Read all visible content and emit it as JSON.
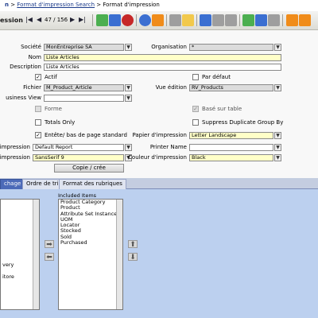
{
  "breadcrumb": {
    "home": "n",
    "sep": ">",
    "link": "Format d'impression Search",
    "current": "Format d'impression"
  },
  "toolbar": {
    "title": "ession",
    "nav_first": "|◀",
    "nav_prev": "◀",
    "record_count": "47 / 156",
    "nav_next": "▶",
    "nav_last": "▶|",
    "colors": {
      "green": "#4caf50",
      "blue": "#3b6fd1",
      "red": "#c62828",
      "orange": "#f08c1a",
      "yellow": "#f2c94c",
      "gray": "#9e9e9e"
    }
  },
  "form": {
    "societe": {
      "label": "Société",
      "value": "MonEntreprise SA"
    },
    "organisation": {
      "label": "Organisation",
      "value": "*"
    },
    "nom": {
      "label": "Nom",
      "value": "Liste Articles"
    },
    "description": {
      "label": "Description",
      "value": "Liste Articles"
    },
    "actif": {
      "label": "Actif",
      "checked": true
    },
    "par_defaut": {
      "label": "Par défaut",
      "checked": false
    },
    "fichier": {
      "label": "Fichier",
      "value": "M_Product_Article"
    },
    "vue_edition": {
      "label": "Vue édition",
      "value": "RV_Products"
    },
    "business_view": {
      "label": "usiness View",
      "value": ""
    },
    "forme": {
      "label": "Forme",
      "checked": false
    },
    "base_sur_table": {
      "label": "Basé sur table",
      "checked": true
    },
    "totals_only": {
      "label": "Totals Only",
      "checked": false
    },
    "suppress_dup": {
      "label": "Suppress Duplicate Group By",
      "checked": false
    },
    "entete": {
      "label": "Entête/ bas de page standard",
      "checked": true
    },
    "papier": {
      "label": "Papier d'impression",
      "value": "Letter Landscape"
    },
    "format_impression": {
      "label": "d'impression",
      "value": "Default Report"
    },
    "printer_name": {
      "label": "Printer Name",
      "value": ""
    },
    "police": {
      "label": "d'impression",
      "value": "SansSerif 9"
    },
    "couleur": {
      "label": "Couleur d'impression",
      "value": "Black"
    },
    "copie_button": "Copie / crée"
  },
  "tabs": [
    {
      "label": "chage",
      "active": true
    },
    {
      "label": "Ordre de tri",
      "active": false
    },
    {
      "label": "Format des rubriques",
      "active": false
    }
  ],
  "panel": {
    "left_items": [
      "very",
      "itore"
    ],
    "included_title": "Included Items",
    "included_items": [
      "Product Category",
      "Product",
      "Attribute Set Instance",
      "UOM",
      "Locator",
      "Stocked",
      "Sold",
      "Purchased"
    ]
  }
}
